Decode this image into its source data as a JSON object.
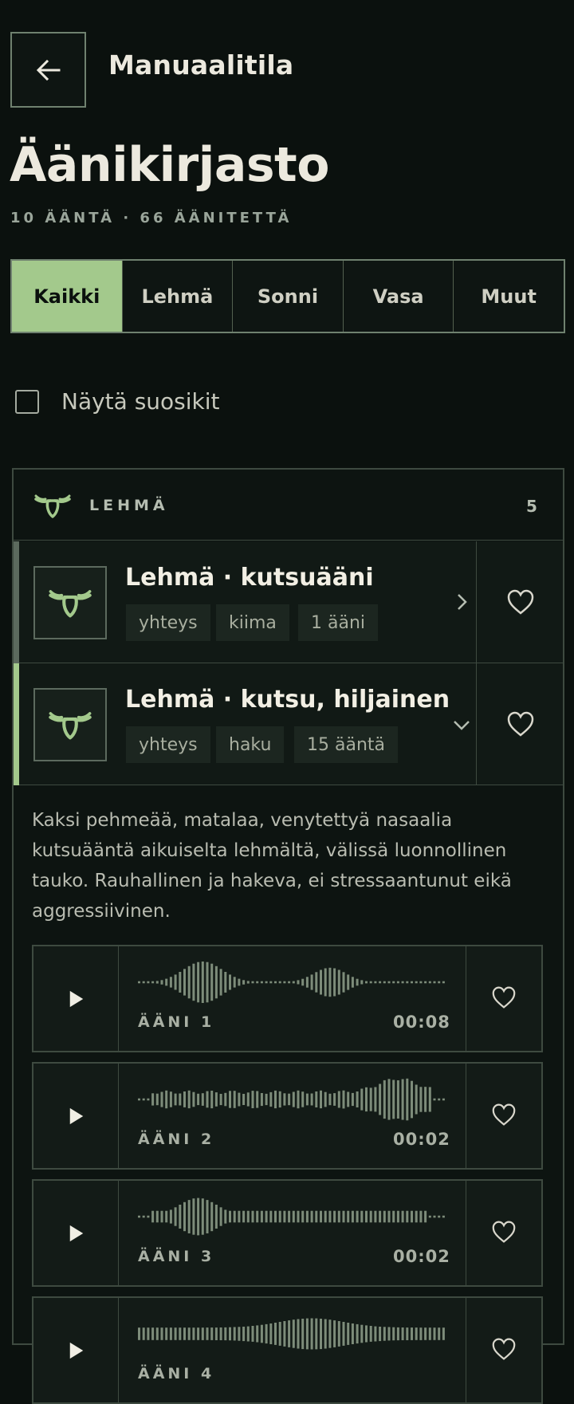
{
  "header": {
    "back_icon": "arrow-left-icon",
    "mode_title": "Manuaalitila"
  },
  "page": {
    "title": "Äänikirjasto",
    "subtitle": "10 ÄÄNTÄ · 66 ÄÄNITETTÄ"
  },
  "tabs": [
    {
      "label": "Kaikki",
      "active": true
    },
    {
      "label": "Lehmä",
      "active": false
    },
    {
      "label": "Sonni",
      "active": false
    },
    {
      "label": "Vasa",
      "active": false
    },
    {
      "label": "Muut",
      "active": false
    }
  ],
  "favorites_filter": {
    "label": "Näytä suosikit",
    "checked": false
  },
  "group": {
    "label": "LEHMÄ",
    "count": "5",
    "icon": "moose-head-icon",
    "items": [
      {
        "title": "Lehmä · kutsuääni",
        "chips": [
          "yhteys",
          "kiima",
          "1 ääni"
        ],
        "expanded": false,
        "chevron": "chevron-right-icon"
      },
      {
        "title": "Lehmä · kutsu, hiljainen",
        "chips": [
          "yhteys",
          "haku",
          "15 ääntä"
        ],
        "expanded": true,
        "chevron": "chevron-down-icon"
      }
    ]
  },
  "expanded_item": {
    "description": "Kaksi pehmeää, matalaa, venytettyä nasaalia kutsuääntä aikuiselta lehmältä, välissä luonnollinen tauko. Rauhallinen ja hakeva, ei stressaantunut eikä aggressiivinen.",
    "clips": [
      {
        "name": "ÄÄNI 1",
        "duration": "00:08"
      },
      {
        "name": "ÄÄNI 2",
        "duration": "00:02"
      },
      {
        "name": "ÄÄNI 3",
        "duration": "00:02"
      },
      {
        "name": "ÄÄNI 4",
        "duration": ""
      }
    ]
  },
  "colors": {
    "background": "#0b110e",
    "accent": "#a3c98c",
    "border": "#6f816f",
    "text": "#ece9de"
  }
}
